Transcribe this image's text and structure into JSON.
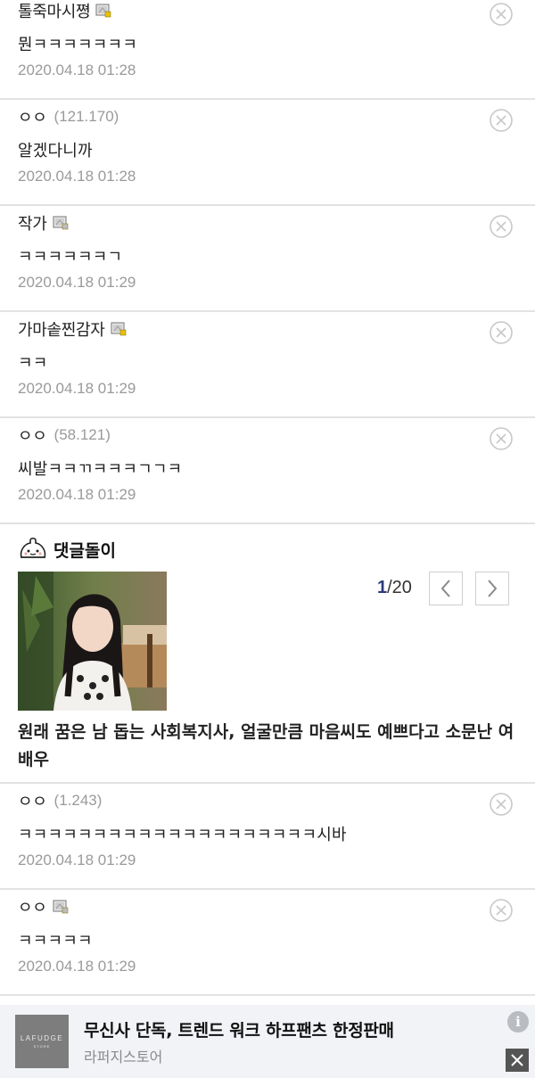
{
  "comments_top": [
    {
      "name": "톨죽마시쪙",
      "ip": "",
      "member": true,
      "member_color": "#e8c200",
      "body": "뭔ㅋㅋㅋㅋㅋㅋㅋ",
      "date": "2020.04.18 01:28"
    },
    {
      "name": "ㅇㅇ",
      "ip": "(121.170)",
      "member": false,
      "body": "알겠다니까",
      "date": "2020.04.18 01:28"
    },
    {
      "name": "작가",
      "ip": "",
      "member": true,
      "member_color": "#bdbdbd",
      "body": "ㅋㅋㅋㅋㅋㅋㄱ",
      "date": "2020.04.18 01:29"
    },
    {
      "name": "가마솥찐감자",
      "ip": "",
      "member": true,
      "member_color": "#e8c200",
      "body": "ㅋㅋ",
      "date": "2020.04.18 01:29"
    },
    {
      "name": "ㅇㅇ",
      "ip": "(58.121)",
      "member": false,
      "body": "씨발ㅋㅋㄲㅋㅋㅋㄱㄱㅋ",
      "date": "2020.04.18 01:29"
    }
  ],
  "bot": {
    "title": "댓글돌이",
    "page_current": "1",
    "page_sep_total": "/20",
    "headline": "원래 꿈은 남 돕는 사회복지사, 얼굴만큼 마음씨도 예쁘다고 소문난 여배우"
  },
  "comments_bottom": [
    {
      "name": "ㅇㅇ",
      "ip": "(1.243)",
      "member": false,
      "body": "ㅋㅋㅋㅋㅋㅋㅋㅋㅋㅋㅋㅋㅋㅋㅋㅋㅋㅋㅋㅋ시바",
      "date": "2020.04.18 01:29"
    },
    {
      "name": "ㅇㅇ",
      "ip": "",
      "member": true,
      "member_color": "#bdbdbd",
      "body": "ㅋㅋㅋㅋㅋ",
      "date": "2020.04.18 01:29"
    }
  ],
  "ad": {
    "logo_text": "LAFUDGE",
    "logo_sub": "STORE",
    "title": "무신사 단독, 트렌드 워크 하프팬츠 한정판매",
    "advertiser": "라퍼지스토어",
    "info_glyph": "i"
  },
  "icons": {
    "delete": "circle-x-icon",
    "member": "gallog-icon",
    "prev": "chevron-left-icon",
    "next": "chevron-right-icon",
    "close": "close-icon",
    "info": "info-icon"
  }
}
